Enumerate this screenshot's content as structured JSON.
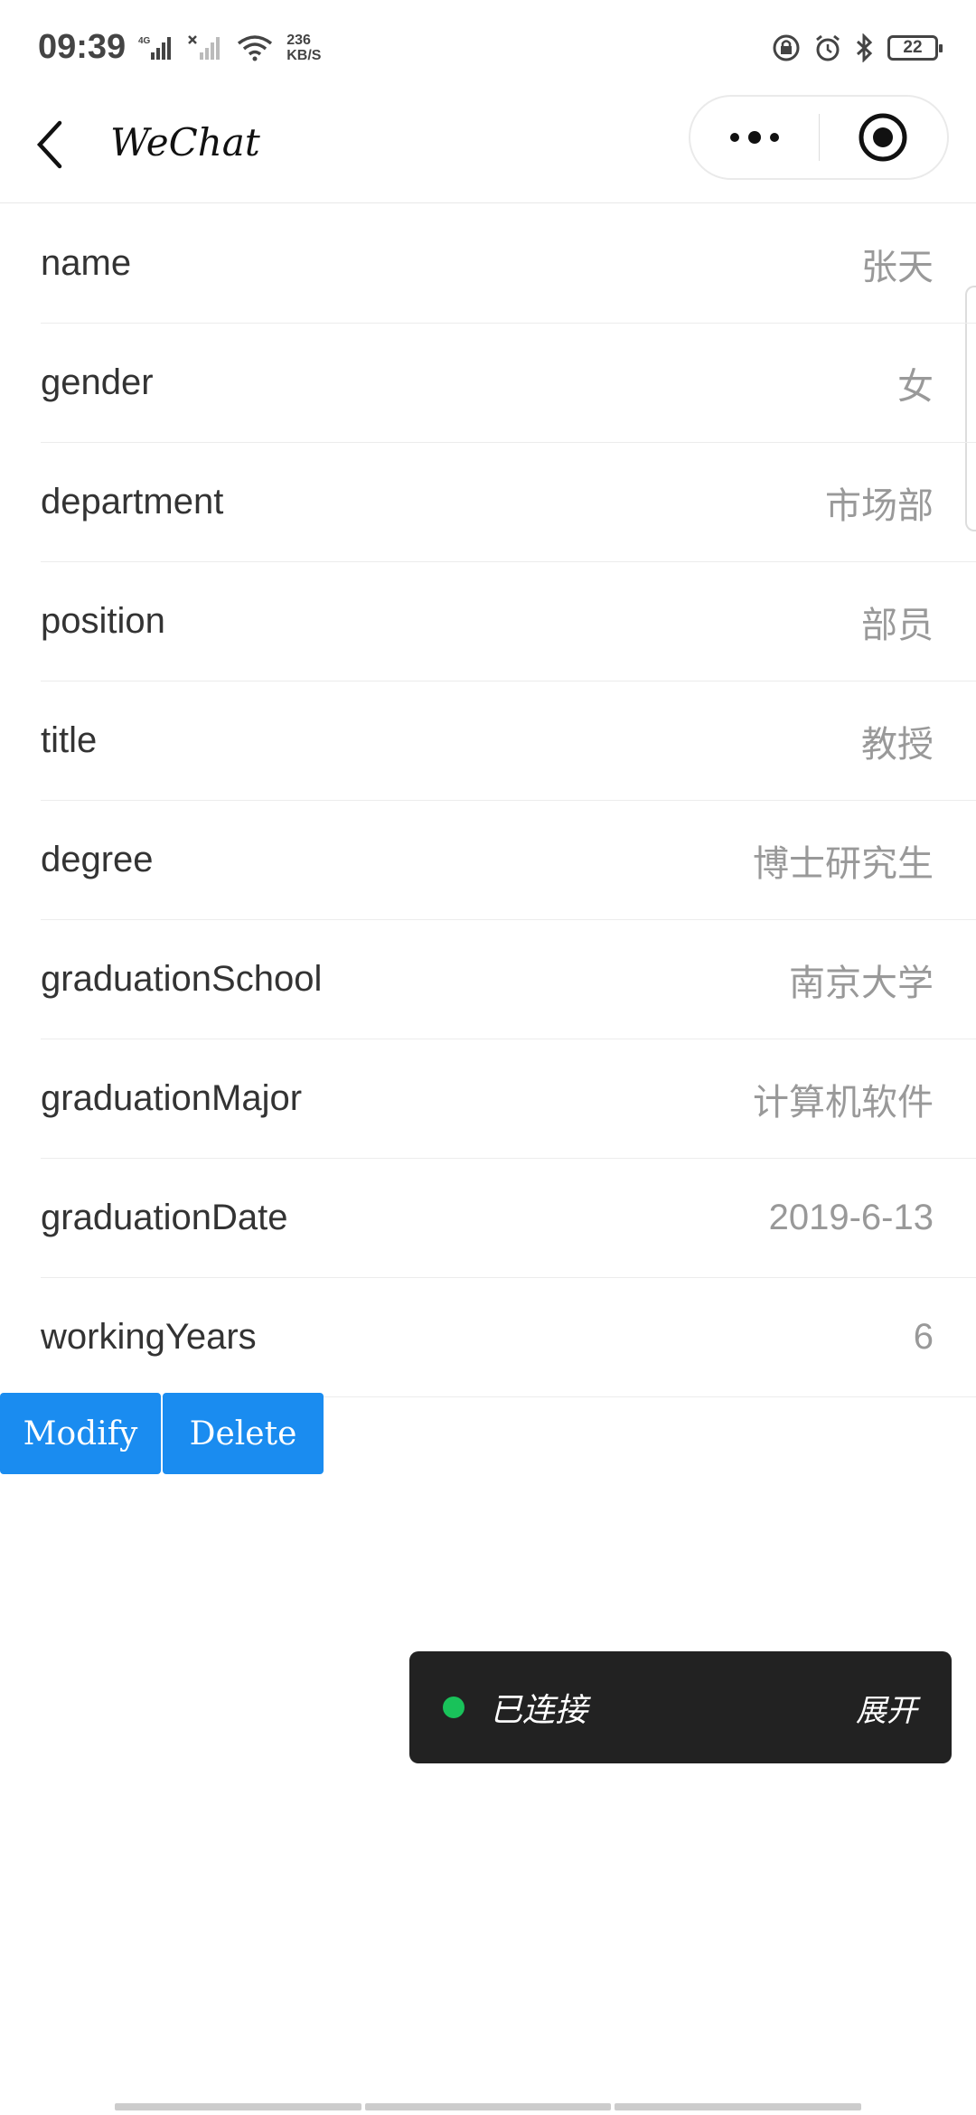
{
  "status_bar": {
    "time": "09:39",
    "network_label": "4G",
    "speed_value": "236",
    "speed_unit": "KB/S",
    "battery": "22"
  },
  "nav": {
    "title": "WeChat",
    "menu_icon": "more-dots-icon",
    "close_icon": "record-target-icon"
  },
  "fields": [
    {
      "label": "name",
      "value": "张天"
    },
    {
      "label": "gender",
      "value": "女"
    },
    {
      "label": "department",
      "value": "市场部"
    },
    {
      "label": "position",
      "value": "部员"
    },
    {
      "label": "title",
      "value": "教授"
    },
    {
      "label": "degree",
      "value": "博士研究生"
    },
    {
      "label": "graduationSchool",
      "value": "南京大学"
    },
    {
      "label": "graduationMajor",
      "value": "计算机软件"
    },
    {
      "label": "graduationDate",
      "value": "2019-6-13"
    },
    {
      "label": "workingYears",
      "value": "6"
    }
  ],
  "actions": {
    "modify_label": "Modify",
    "delete_label": "Delete"
  },
  "toast": {
    "status_text": "已连接",
    "expand_label": "展开",
    "status_color": "#19c25a"
  },
  "colors": {
    "button_blue": "#1a8cf0",
    "toast_bg": "#222222"
  }
}
